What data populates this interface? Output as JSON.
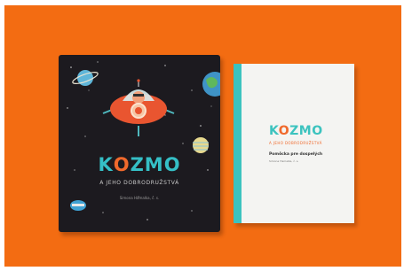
{
  "scene": {
    "description_colors": {
      "background": "#f36c12",
      "dark_cover": "#1c1a1f",
      "teal_accent": "#35bfc6",
      "orange_accent": "#f0692c",
      "booklet_paper": "#f4f4f2"
    }
  },
  "dark_book": {
    "title_prefix": "K",
    "title_o": "O",
    "title_suffix": "ZMO",
    "subtitle": "A JEHO DOBRODRUŽSTVÁ",
    "author": "Simona Hamalka, č. s."
  },
  "light_book": {
    "title_prefix": "K",
    "title_o": "O",
    "title_suffix": "ZMO",
    "subtitle": "A JEHO DOBRODRUŽSTVÁ",
    "heading": "Pomôcka pre dospelých",
    "small": "Simona Hamalka, č. s."
  }
}
